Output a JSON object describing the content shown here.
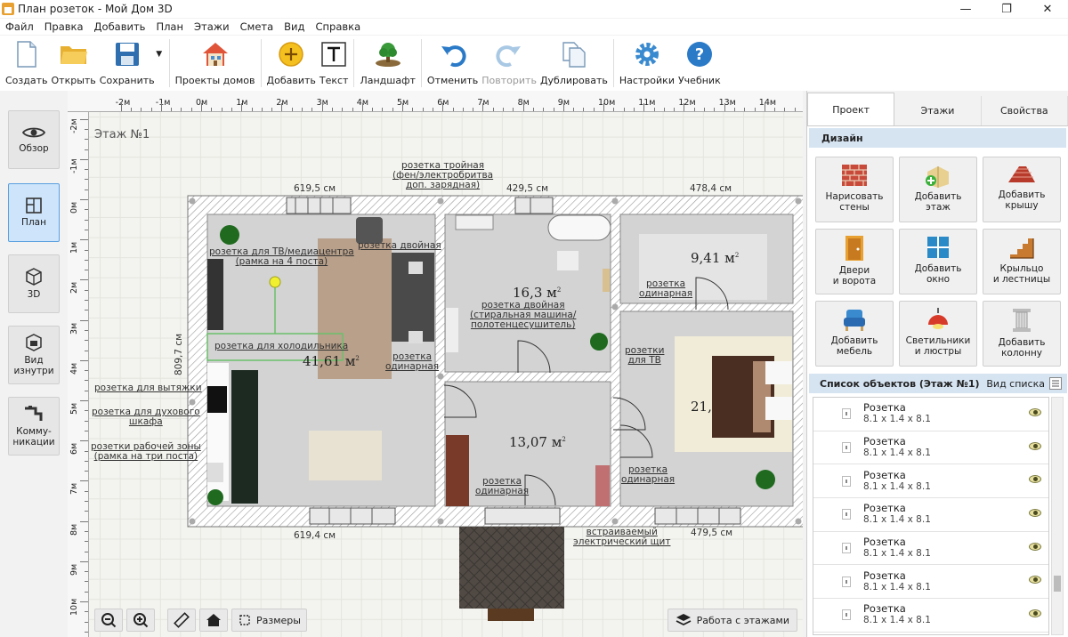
{
  "window": {
    "title": "План розеток - Мой Дом 3D"
  },
  "menu": [
    "Файл",
    "Правка",
    "Добавить",
    "План",
    "Этажи",
    "Смета",
    "Вид",
    "Справка"
  ],
  "toolbar": {
    "buttons": [
      {
        "label": "Создать",
        "icon": "new-file-icon",
        "enabled": true
      },
      {
        "label": "Открыть",
        "icon": "open-folder-icon",
        "enabled": true
      },
      {
        "label": "Сохранить",
        "icon": "save-icon",
        "enabled": true
      },
      {
        "label": "Проекты домов",
        "icon": "house-projects-icon",
        "enabled": true
      },
      {
        "label": "Добавить",
        "icon": "add-icon",
        "enabled": true
      },
      {
        "label": "Текст",
        "icon": "text-icon",
        "enabled": true
      },
      {
        "label": "Ландшафт",
        "icon": "landscape-icon",
        "enabled": true
      },
      {
        "label": "Отменить",
        "icon": "undo-icon",
        "enabled": true
      },
      {
        "label": "Повторить",
        "icon": "redo-icon",
        "enabled": false
      },
      {
        "label": "Дублировать",
        "icon": "duplicate-icon",
        "enabled": true
      },
      {
        "label": "Настройки",
        "icon": "settings-gear-icon",
        "enabled": true
      },
      {
        "label": "Учебник",
        "icon": "help-icon",
        "enabled": true
      }
    ]
  },
  "sidebar": {
    "items": [
      {
        "label": "Обзор",
        "icon": "eye-icon",
        "active": false
      },
      {
        "label": "План",
        "icon": "plan-icon",
        "active": true
      },
      {
        "label": "3D",
        "icon": "cube-3d-icon",
        "active": false
      },
      {
        "label": "Вид изнутри",
        "icon": "interior-view-icon",
        "active": false
      },
      {
        "label": "Комму-никации",
        "icon": "plumbing-icon",
        "active": false
      }
    ]
  },
  "ruler": {
    "top": [
      "-2м",
      "-1м",
      "0м",
      "1м",
      "2м",
      "3м",
      "4м",
      "5м",
      "6м",
      "7м",
      "8м",
      "9м",
      "10м",
      "11м",
      "12м",
      "13м",
      "14м"
    ],
    "left": [
      "-2м",
      "-1м",
      "0м",
      "1м",
      "2м",
      "3м",
      "4м",
      "5м",
      "6м",
      "7м",
      "8м",
      "9м",
      "10м"
    ]
  },
  "plan": {
    "floor_label": "Этаж №1",
    "dimensions": {
      "top1": "619,5 см",
      "top2": "429,5 см",
      "top3": "478,4 см",
      "bottom1": "619,4 см",
      "bottom2": "479,5 см",
      "left": "809,7 см"
    },
    "areas": {
      "r1": "41,61 м",
      "r2": "16,3 м",
      "r3": "9,41 м",
      "r4": "13,07 м",
      "r5": "21,"
    },
    "sup": "2",
    "labels": {
      "l1": "розетка тройная\n(фен/электробритва\nдоп. зарядная)",
      "l2": "розетка для ТВ/медиацентра\n(рамка на 4 поста)",
      "l3": "розетка двойная",
      "l4": "розетка для холодильника",
      "l5": "розетка\nодинарная",
      "l6": "розетка двойная\n(стиральная машина/\nполотенцесушитель)",
      "l7": "розетка\nодинарная",
      "l8": "розетки\nдля ТВ",
      "l9": "розетка для вытяжки",
      "l10": "розетка для духового\nшкафа",
      "l11": "розетки рабочей зоны\n(рамка на три поста)",
      "l12": "розетка\nодинарная",
      "l13": "розетка\nодинарная",
      "l14": "встраиваемый\nэлектрический щит"
    }
  },
  "bottom_tools": {
    "dims": "Размеры",
    "floors": "Работа с этажами"
  },
  "panel": {
    "tabs": [
      "Проект",
      "Этажи",
      "Свойства"
    ],
    "active_tab": "Проект",
    "design_header": "Дизайн",
    "design_buttons": [
      {
        "label": "Нарисовать\nстены",
        "icon": "brick-wall-icon"
      },
      {
        "label": "Добавить\nэтаж",
        "icon": "add-floor-icon"
      },
      {
        "label": "Добавить\nкрышу",
        "icon": "roof-icon"
      },
      {
        "label": "Двери\nи ворота",
        "icon": "door-icon"
      },
      {
        "label": "Добавить\nокно",
        "icon": "window-icon"
      },
      {
        "label": "Крыльцо\nи лестницы",
        "icon": "stairs-icon"
      },
      {
        "label": "Добавить\nмебель",
        "icon": "armchair-icon"
      },
      {
        "label": "Светильники\nи люстры",
        "icon": "lamp-icon"
      },
      {
        "label": "Добавить\nколонну",
        "icon": "column-icon"
      }
    ],
    "objects_header": "Список объектов (Этаж №1)",
    "list_view": "Вид списка",
    "objects": [
      {
        "name": "Розетка",
        "size": "8.1 x 1.4 x 8.1"
      },
      {
        "name": "Розетка",
        "size": "8.1 x 1.4 x 8.1"
      },
      {
        "name": "Розетка",
        "size": "8.1 x 1.4 x 8.1"
      },
      {
        "name": "Розетка",
        "size": "8.1 x 1.4 x 8.1"
      },
      {
        "name": "Розетка",
        "size": "8.1 x 1.4 x 8.1"
      },
      {
        "name": "Розетка",
        "size": "8.1 x 1.4 x 8.1"
      },
      {
        "name": "Розетка",
        "size": "8.1 x 1.4 x 8.1"
      }
    ]
  }
}
